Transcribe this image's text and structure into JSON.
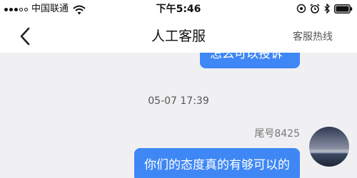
{
  "status_bar": {
    "carrier": "中国联通",
    "time": "下午5:46"
  },
  "nav": {
    "title": "人工客服",
    "hotline": "客服热线"
  },
  "chat": {
    "previous_message": "怎么可以投诉",
    "timestamp": "05-07 17:39",
    "sender_label": "尾号8425",
    "message": "你们的态度真的有够可以的"
  },
  "colors": {
    "bubble": "#3f87f5",
    "background": "#f0f0f3"
  },
  "icons": {
    "back": "chevron-left-icon",
    "wifi": "wifi-icon",
    "alarm": "alarm-icon",
    "bluetooth": "bluetooth-icon"
  }
}
